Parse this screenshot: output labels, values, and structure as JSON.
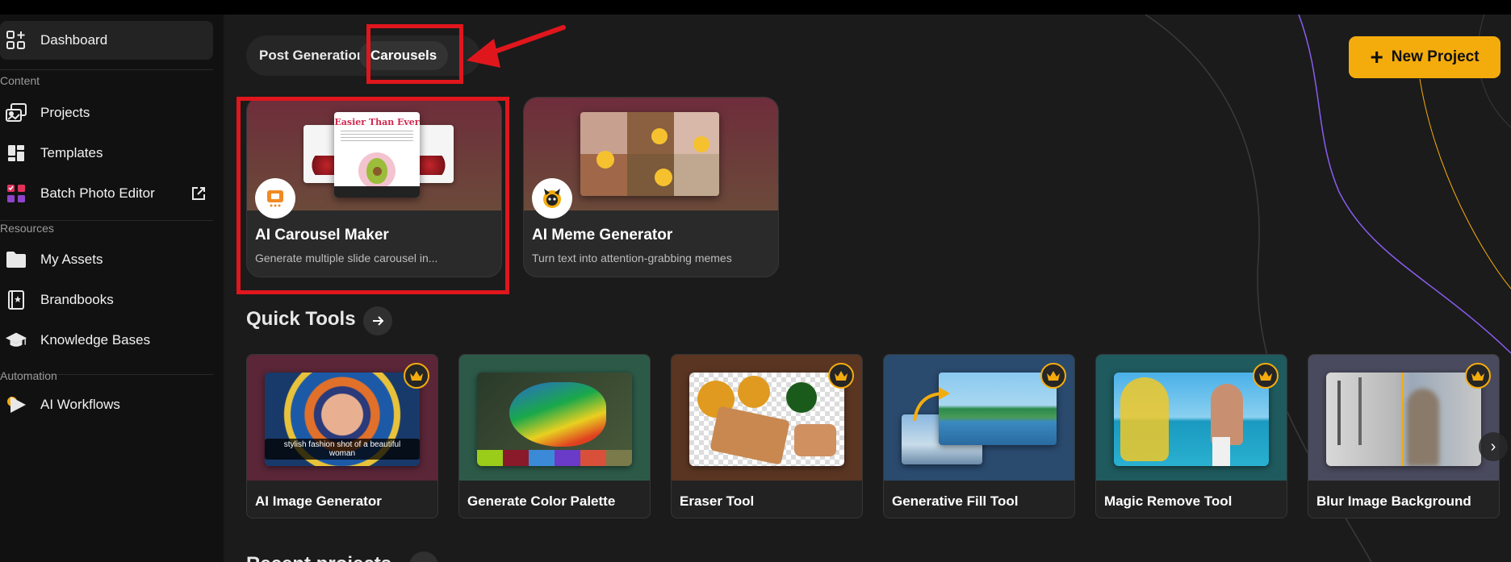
{
  "sidebar": {
    "items": [
      {
        "label": "Dashboard",
        "icon": "dashboard-add-icon",
        "active": true
      },
      {
        "label": "Projects",
        "icon": "projects-icon"
      },
      {
        "label": "Templates",
        "icon": "templates-icon"
      },
      {
        "label": "Batch Photo Editor",
        "icon": "batch-editor-icon",
        "external": "external-link-icon"
      },
      {
        "label": "My Assets",
        "icon": "folder-icon"
      },
      {
        "label": "Brandbooks",
        "icon": "brandbook-icon"
      },
      {
        "label": "Knowledge Bases",
        "icon": "graduation-cap-icon"
      },
      {
        "label": "AI Workflows",
        "icon": "play-icon"
      }
    ],
    "sections": {
      "content": "Content",
      "resources": "Resources",
      "automation": "Automation"
    }
  },
  "tabs": [
    {
      "label": "Post Generation",
      "active": false
    },
    {
      "label": "Carousels",
      "active": true
    }
  ],
  "header": {
    "new_project_label": "New Project",
    "accent_color": "#f4ac0d"
  },
  "generators": [
    {
      "title": "AI Carousel Maker",
      "description": "Generate multiple slide carousel in...",
      "banner_text": "Easier Than Ever",
      "icon": "carousel-maker-icon"
    },
    {
      "title": "AI Meme Generator",
      "description": "Turn text into attention-grabbing memes",
      "icon": "meme-generator-icon"
    }
  ],
  "quick_tools": {
    "title": "Quick Tools",
    "items": [
      {
        "name": "AI Image Generator",
        "caption": "stylish fashion shot of a beautiful woman",
        "premium": true
      },
      {
        "name": "Generate Color Palette",
        "premium": false
      },
      {
        "name": "Eraser Tool",
        "premium": true
      },
      {
        "name": "Generative Fill Tool",
        "premium": true
      },
      {
        "name": "Magic Remove Tool",
        "premium": true
      },
      {
        "name": "Blur Image Background",
        "premium": true
      }
    ]
  },
  "recent_projects": {
    "title": "Recent projects"
  },
  "annotation_color": "#e0161d"
}
